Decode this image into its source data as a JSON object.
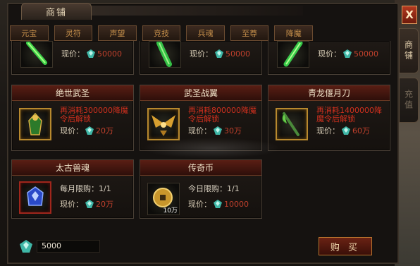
{
  "window": {
    "title": "商铺",
    "close_label": "X"
  },
  "side_tabs": [
    {
      "label": "商铺",
      "active": true
    },
    {
      "label": "充值",
      "active": false
    }
  ],
  "categories": [
    "元宝",
    "灵符",
    "声望",
    "竞技",
    "兵魂",
    "至尊",
    "降魔"
  ],
  "price_label": "现价：",
  "cards": [
    {
      "title": "",
      "price": "50000",
      "icon": "green-blade-icon"
    },
    {
      "title": "",
      "price": "50000",
      "icon": "green-armor-icon"
    },
    {
      "title": "",
      "price": "50000",
      "icon": "green-spear-icon"
    },
    {
      "title": "绝世武圣",
      "note": "再消耗300000降魔令后解锁",
      "price": "20万",
      "icon": "warrior-armor-icon"
    },
    {
      "title": "武圣战翼",
      "note": "再消耗800000降魔令后解锁",
      "price": "30万",
      "icon": "golden-wings-icon"
    },
    {
      "title": "青龙偃月刀",
      "note": "再消耗1400000降魔令后解锁",
      "price": "60万",
      "icon": "dragon-blade-icon"
    },
    {
      "title": "太古兽魂",
      "limit": "每月限购：1/1",
      "price": "20万",
      "icon": "beast-soul-icon"
    },
    {
      "title": "传奇币",
      "limit": "今日限购：1/1",
      "price": "10000",
      "stack": "10万",
      "icon": "coin-icon"
    }
  ],
  "footer": {
    "balance": "5000",
    "buy_label": "购 买"
  },
  "colors": {
    "accent_red": "#c0402c",
    "gem_teal": "#3fb7a7",
    "gold_border": "#b8892e"
  }
}
